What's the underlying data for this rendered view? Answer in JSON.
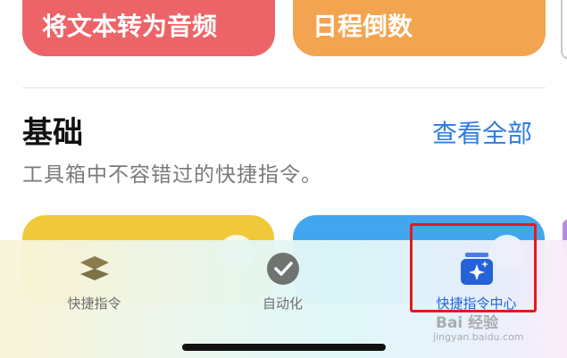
{
  "cards_top": [
    {
      "label": "将文本转为音频",
      "color": "#ec6468"
    },
    {
      "label": "日程倒数",
      "color": "#f3a450"
    }
  ],
  "section": {
    "title": "基础",
    "see_all": "查看全部",
    "subtitle": "工具箱中不容错过的快捷指令。"
  },
  "cards_bottom": [
    {
      "color": "#f0c93a"
    },
    {
      "color": "#41a6ee"
    }
  ],
  "tab_bar": {
    "tabs": [
      {
        "label": "快捷指令",
        "icon": "layers-icon",
        "active": false
      },
      {
        "label": "自动化",
        "icon": "clock-check-icon",
        "active": false
      },
      {
        "label": "快捷指令中心",
        "icon": "gallery-sparkle-icon",
        "active": true
      }
    ],
    "accent_color": "#2562d8"
  },
  "watermark": {
    "text": "Bai 经验",
    "url_text": "jingyan.baidu.com"
  },
  "highlight_color": "#e31b1b"
}
